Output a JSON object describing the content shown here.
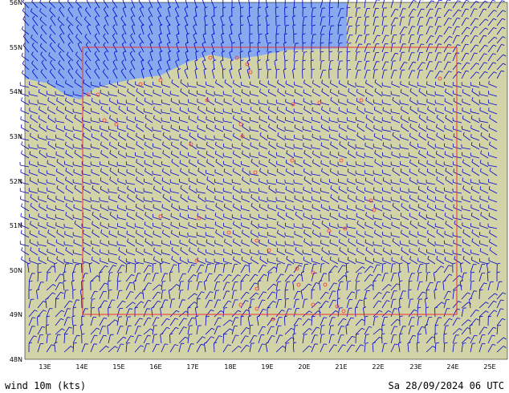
{
  "map": {
    "lat_labels": [
      "56N",
      "55N",
      "54N",
      "53N",
      "52N",
      "51N",
      "50N",
      "49N",
      "48N"
    ],
    "lon_labels": [
      "13E",
      "14E",
      "15E",
      "16E",
      "17E",
      "18E",
      "19E",
      "20E",
      "21E",
      "22E",
      "23E",
      "24E",
      "25E"
    ],
    "colors": {
      "land": "#d3d3a8",
      "sea": "#87a9ee",
      "wind_barb": "#0000cc",
      "region_box": "#e83030",
      "stations": "#ff3030",
      "axis_text": "#000000"
    }
  },
  "footer": {
    "field_label": "wind 10m (kts)",
    "valid_time": "Sa 28/09/2024 06 UTC"
  }
}
